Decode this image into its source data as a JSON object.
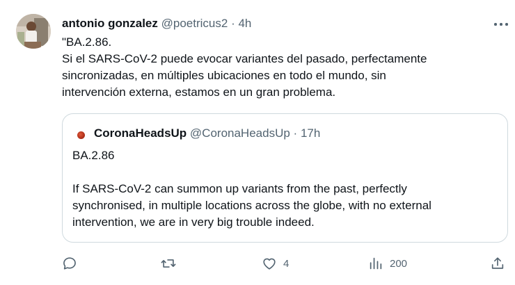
{
  "tweet": {
    "author_name": "antonio gonzalez",
    "handle": "@poetricus2",
    "separator": "·",
    "time": "4h",
    "text_lines": [
      "\"BA.2.86.",
      "Si el SARS-CoV-2 puede evocar variantes del pasado, perfectamente",
      "sincronizadas, en múltiples ubicaciones en todo el mundo, sin",
      "intervención externa, estamos en un gran problema."
    ]
  },
  "quoted": {
    "author_name": "CoronaHeadsUp",
    "handle": "@CoronaHeadsUp",
    "separator": "·",
    "time": "17h",
    "text_lines": [
      "BA.2.86",
      "",
      "If SARS-CoV-2 can summon up variants from the past, perfectly",
      "synchronised, in multiple locations across the globe, with no external",
      "intervention, we are in very big trouble indeed."
    ]
  },
  "actions": {
    "reply": {
      "icon": "reply-icon",
      "count": ""
    },
    "retweet": {
      "icon": "retweet-icon",
      "count": ""
    },
    "like": {
      "icon": "heart-icon",
      "count": "4"
    },
    "views": {
      "icon": "views-icon",
      "count": "200"
    },
    "share": {
      "icon": "share-icon",
      "count": ""
    }
  },
  "colors": {
    "text": "#0f1419",
    "muted": "#536471",
    "border": "#cfd9de",
    "background": "#ffffff"
  }
}
